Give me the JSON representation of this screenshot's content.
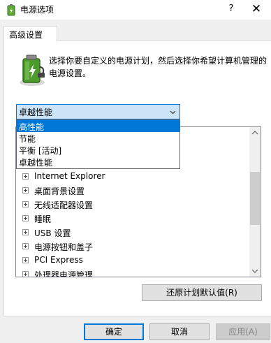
{
  "window": {
    "title": "电源选项",
    "help_label": "?",
    "close_label": "✕",
    "icon": "power-options-icon"
  },
  "tab": {
    "label": "高级设置"
  },
  "description": "选择你要自定义的电源计划，然后选择你希望计算机管理的电源设置。",
  "plan_combo": {
    "selected": "卓越性能",
    "options": [
      "高性能",
      "节能",
      "平衡 [活动]",
      "卓越性能"
    ],
    "highlighted_index": 0
  },
  "settings_tree": {
    "items": [
      "Internet Explorer",
      "桌面背景设置",
      "无线适配器设置",
      "睡眠",
      "USB 设置",
      "电源按钮和盖子",
      "PCI Express",
      "处理器电源管理"
    ]
  },
  "buttons": {
    "restore_defaults": "还原计划默认值(R)",
    "ok": "确定",
    "cancel": "取消",
    "apply": "应用(A)"
  },
  "colors": {
    "accent": "#0078d7",
    "selection_bg": "#cce4f7"
  }
}
